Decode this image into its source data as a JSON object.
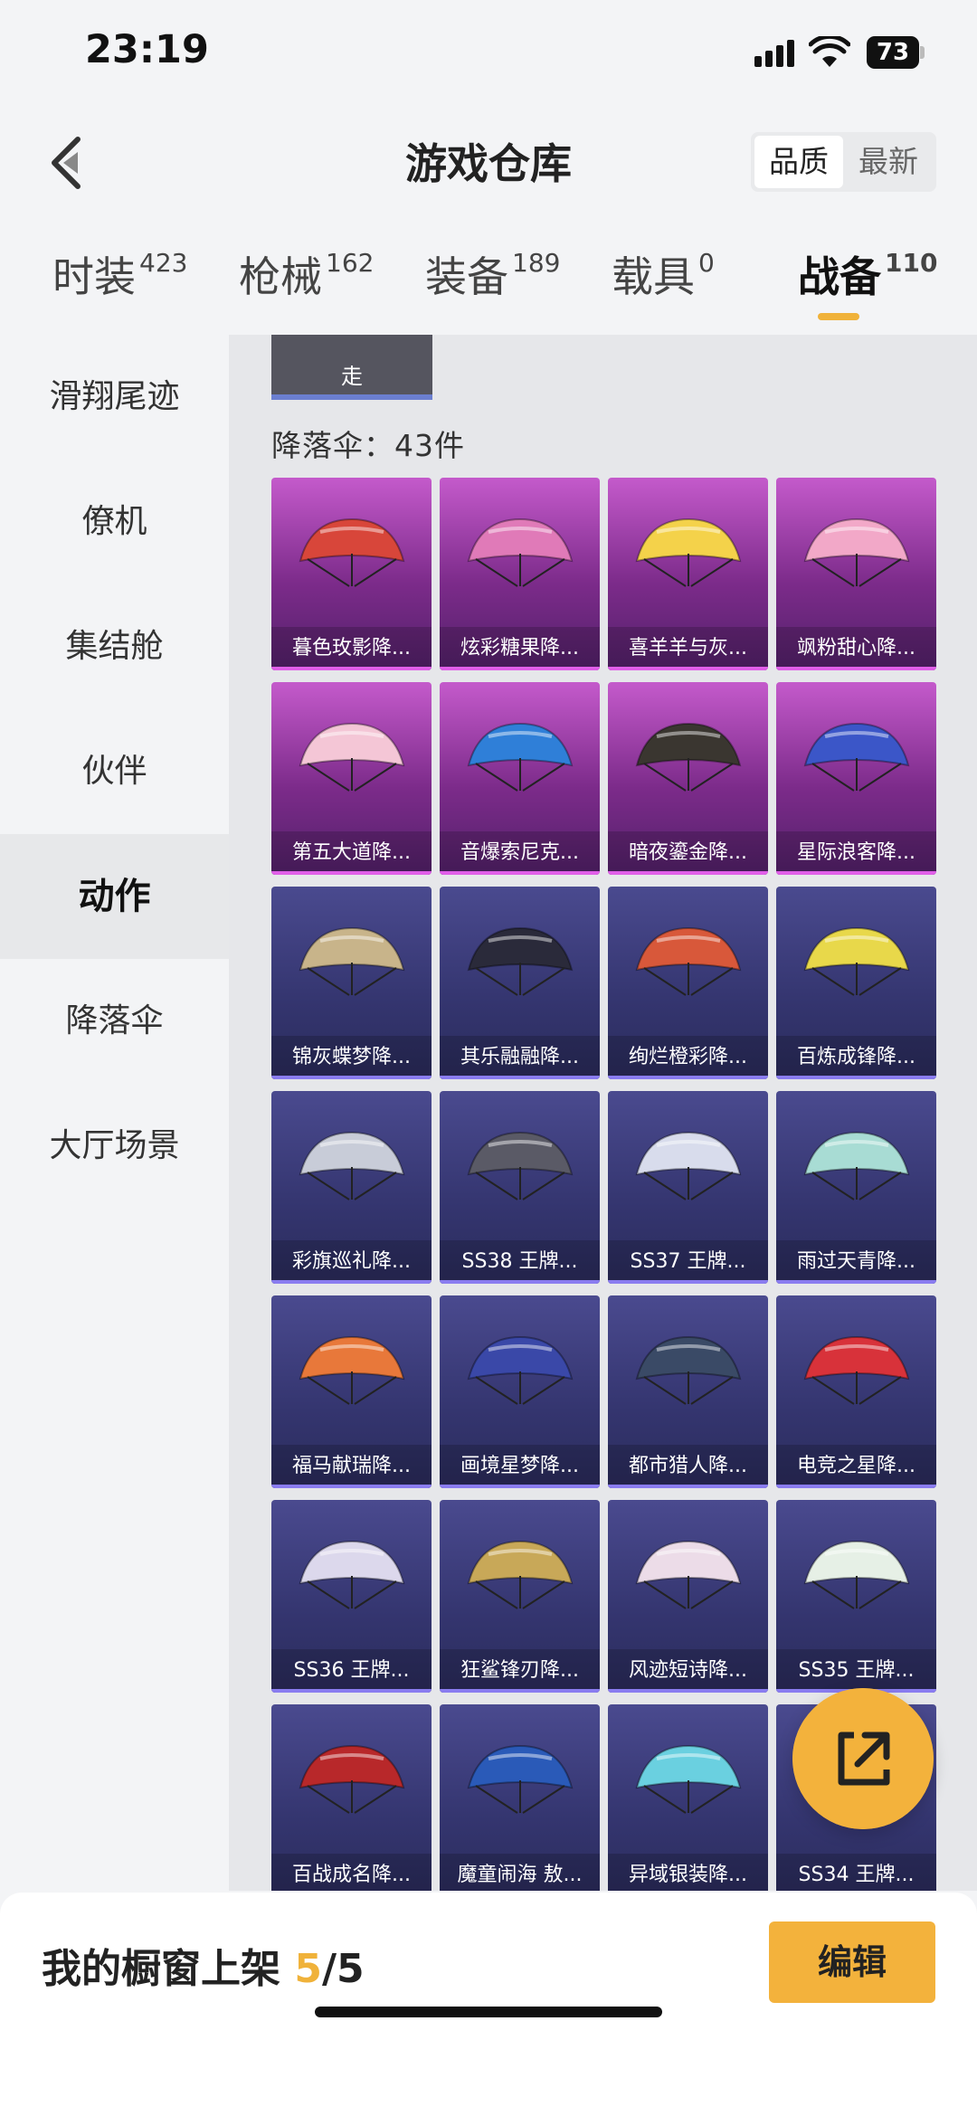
{
  "status_bar": {
    "time": "23:19",
    "battery": "73"
  },
  "header": {
    "title": "游戏仓库",
    "sort": [
      "品质",
      "最新"
    ]
  },
  "tabs": [
    {
      "label": "时装",
      "count": "423"
    },
    {
      "label": "枪械",
      "count": "162"
    },
    {
      "label": "装备",
      "count": "189"
    },
    {
      "label": "载具",
      "count": "0"
    },
    {
      "label": "战备",
      "count": "110"
    }
  ],
  "sidebar": [
    "滑翔尾迹",
    "僚机",
    "集结舱",
    "伙伴",
    "动作",
    "降落伞",
    "大厅场景"
  ],
  "section": {
    "previous_tile_label": "走",
    "title": "降落伞：43件"
  },
  "items": [
    {
      "name": "暮色玫影降...",
      "rarity": "purple",
      "color": "#d8463a"
    },
    {
      "name": "炫彩糖果降...",
      "rarity": "purple",
      "color": "#e07ab8"
    },
    {
      "name": "喜羊羊与灰...",
      "rarity": "purple",
      "color": "#f4d24a"
    },
    {
      "name": "飒粉甜心降...",
      "rarity": "purple",
      "color": "#f2a8c8"
    },
    {
      "name": "第五大道降...",
      "rarity": "purple",
      "color": "#f4c6d6"
    },
    {
      "name": "音爆索尼克...",
      "rarity": "purple",
      "color": "#2f7fd8"
    },
    {
      "name": "暗夜鎏金降...",
      "rarity": "purple",
      "color": "#3a3630"
    },
    {
      "name": "星际浪客降...",
      "rarity": "purple",
      "color": "#3b56c8"
    },
    {
      "name": "锦灰蝶梦降...",
      "rarity": "blue",
      "color": "#c8b48a"
    },
    {
      "name": "其乐融融降...",
      "rarity": "blue",
      "color": "#2a2a3a"
    },
    {
      "name": "绚烂橙彩降...",
      "rarity": "blue",
      "color": "#d8583a"
    },
    {
      "name": "百炼成锋降...",
      "rarity": "blue",
      "color": "#e8d84a"
    },
    {
      "name": "彩旗巡礼降...",
      "rarity": "blue",
      "color": "#c8ccd8"
    },
    {
      "name": "SS38 王牌...",
      "rarity": "blue",
      "color": "#5a5a66"
    },
    {
      "name": "SS37 王牌...",
      "rarity": "blue",
      "color": "#d8dcec"
    },
    {
      "name": "雨过天青降...",
      "rarity": "blue",
      "color": "#a8dcd4"
    },
    {
      "name": "福马献瑞降...",
      "rarity": "blue",
      "color": "#e8783a"
    },
    {
      "name": "画境星梦降...",
      "rarity": "blue",
      "color": "#3a48a8"
    },
    {
      "name": "都市猎人降...",
      "rarity": "blue",
      "color": "#3a4a66"
    },
    {
      "name": "电竞之星降...",
      "rarity": "blue",
      "color": "#d8323a"
    },
    {
      "name": "SS36 王牌...",
      "rarity": "blue",
      "color": "#dcd8ec"
    },
    {
      "name": "狂鲨锋刃降...",
      "rarity": "blue",
      "color": "#c8a858"
    },
    {
      "name": "风迹短诗降...",
      "rarity": "blue",
      "color": "#ecdce8"
    },
    {
      "name": "SS35 王牌...",
      "rarity": "blue",
      "color": "#e6f0e6"
    },
    {
      "name": "百战成名降...",
      "rarity": "blue",
      "color": "#b8282a"
    },
    {
      "name": "魔童闹海 敖...",
      "rarity": "blue",
      "color": "#2a5ab8"
    },
    {
      "name": "异域银装降...",
      "rarity": "blue",
      "color": "#6ad0e0"
    },
    {
      "name": "SS34 王牌...",
      "rarity": "blue",
      "color": "#7ad8d8"
    }
  ],
  "bottom_bar": {
    "label": "我的橱窗上架",
    "current": "5",
    "total": "/5",
    "edit": "编辑"
  },
  "colors": {
    "accent": "#f3b23c",
    "purple_tier": "#7c2b8a",
    "blue_tier": "#34356f"
  }
}
